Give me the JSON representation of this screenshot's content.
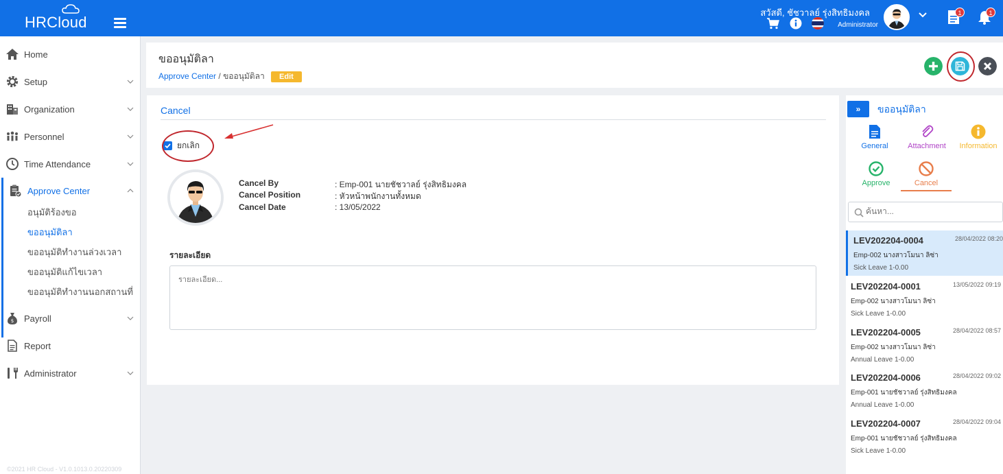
{
  "app": {
    "logo": "HRCloud",
    "greeting": "สวัสดี, ชัชวาลย์ รุ่งสิทธิมงคล",
    "role": "Administrator",
    "doc_badge": "1",
    "bell_badge": "1"
  },
  "sidebar": {
    "items": [
      {
        "label": "Home"
      },
      {
        "label": "Setup"
      },
      {
        "label": "Organization"
      },
      {
        "label": "Personnel"
      },
      {
        "label": "Time Attendance"
      },
      {
        "label": "Approve Center"
      },
      {
        "label": "Payroll"
      },
      {
        "label": "Report"
      },
      {
        "label": "Administrator"
      }
    ],
    "sub_items": [
      {
        "label": "อนุมัติร้องขอ"
      },
      {
        "label": "ขออนุมัติลา"
      },
      {
        "label": "ขออนุมัติทำงานล่วงเวลา"
      },
      {
        "label": "ขออนุมัติแก้ไขเวลา"
      },
      {
        "label": "ขออนุมัติทำงานนอกสถานที่"
      }
    ],
    "footer": "©2021 HR Cloud - V1.0.1013.0.20220309"
  },
  "header": {
    "title": "ขออนุมัติลา",
    "breadcrumb_link": "Approve Center",
    "breadcrumb_sep": "/",
    "breadcrumb_current": "ขออนุมัติลา",
    "mode_badge": "Edit"
  },
  "colors": {
    "primary": "#1170e6",
    "add": "#27b36a",
    "close": "#4a4f57",
    "highlight": "#c0272d",
    "edit": "#f5b82e",
    "cancel": "#e87d4a"
  },
  "form": {
    "section_title": "Cancel",
    "checkbox_label": "ยกเลิก",
    "checkbox_checked": true,
    "fields": [
      {
        "label": "Cancel By",
        "value": ": Emp-001 นายชัชวาลย์ รุ่งสิทธิมงคล"
      },
      {
        "label": "Cancel Position",
        "value": ": หัวหน้าพนักงานทั้งหมด"
      },
      {
        "label": "Cancel Date",
        "value": ": 13/05/2022"
      }
    ],
    "detail_label": "รายละเอียด",
    "detail_placeholder": "รายละเอียด..."
  },
  "right_panel": {
    "title": "ขออนุมัติลา",
    "tabs": [
      {
        "label": "General",
        "icon": "document-icon"
      },
      {
        "label": "Attachment",
        "icon": "paperclip-icon"
      },
      {
        "label": "Information",
        "icon": "info-icon"
      },
      {
        "label": "Approve",
        "icon": "check-circle-icon"
      },
      {
        "label": "Cancel",
        "icon": "ban-icon"
      }
    ],
    "search_placeholder": "ค้นหา...",
    "list": [
      {
        "code": "LEV202204-0004",
        "date": "28/04/2022 08:20",
        "emp": "Emp-002 นางสาวโมนา ลิซ่า",
        "type": "Sick Leave 1-0.00"
      },
      {
        "code": "LEV202204-0001",
        "date": "13/05/2022 09:19",
        "emp": "Emp-002 นางสาวโมนา ลิซ่า",
        "type": "Sick Leave 1-0.00"
      },
      {
        "code": "LEV202204-0005",
        "date": "28/04/2022 08:57",
        "emp": "Emp-002 นางสาวโมนา ลิซ่า",
        "type": "Annual Leave 1-0.00"
      },
      {
        "code": "LEV202204-0006",
        "date": "28/04/2022 09:02",
        "emp": "Emp-001 นายชัชวาลย์ รุ่งสิทธิมงคล",
        "type": "Annual Leave 1-0.00"
      },
      {
        "code": "LEV202204-0007",
        "date": "28/04/2022 09:04",
        "emp": "Emp-001 นายชัชวาลย์ รุ่งสิทธิมงคล",
        "type": "Sick Leave 1-0.00"
      }
    ]
  }
}
